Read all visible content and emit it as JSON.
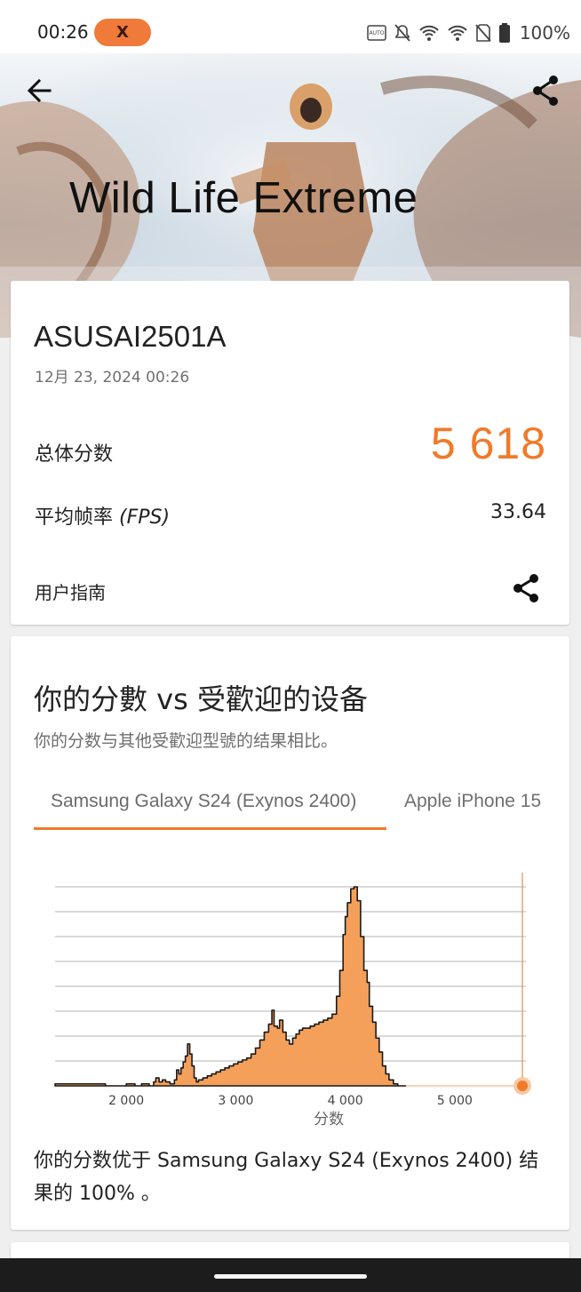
{
  "status_bar": {
    "time": "00:26",
    "badge_text": "X",
    "battery": "100%",
    "icons": [
      "auto-hz-icon",
      "notifications-off-icon",
      "wifi-icon",
      "wifi-icon",
      "no-sim-icon",
      "battery-icon"
    ]
  },
  "header": {
    "title": "Wild Life Extreme",
    "back_icon": "back-arrow-icon",
    "share_icon": "share-icon"
  },
  "result_card": {
    "device_name": "ASUSAI2501A",
    "date": "12月 23, 2024 00:26",
    "total_score_label": "总体分数",
    "total_score": "5 618",
    "fps_label_prefix": "平均帧率 ",
    "fps_label_italic": "(FPS)",
    "fps_value": "33.64",
    "guide_label": "用户指南",
    "score_color": "#f07a2a"
  },
  "compare_card": {
    "title": "你的分數 vs 受歡迎的设备",
    "subtitle": "你的分数与其他受歡迎型號的结果相比。",
    "tabs": [
      {
        "label": "Samsung Galaxy S24 (Exynos 2400)",
        "active": true
      },
      {
        "label": "Apple iPhone 15",
        "active": false
      }
    ],
    "result_text": "你的分数优于 Samsung Galaxy S24 (Exynos 2400) 结果的 100% 。"
  },
  "chart_data": {
    "type": "area",
    "xlabel": "分数",
    "ylabel": "",
    "x_ticks": [
      2000,
      3000,
      4000,
      5000
    ],
    "x_tick_labels": [
      "2 000",
      "3 000",
      "4 000",
      "5 000"
    ],
    "xlim": [
      1350,
      5650
    ],
    "ylim": [
      0,
      100
    ],
    "gridlines": 8,
    "grid": true,
    "fill_color": "#f5a05a",
    "your_score": 5618,
    "series": [
      {
        "x": [
          1350,
          1800,
          1810,
          1990,
          2000,
          2050,
          2080,
          2140,
          2180,
          2210,
          2250,
          2270,
          2300,
          2330,
          2360,
          2400,
          2440,
          2460,
          2480,
          2500,
          2520,
          2540,
          2560,
          2580,
          2600,
          2620,
          2640,
          2660,
          2700,
          2740,
          2780,
          2820,
          2860,
          2900,
          2940,
          2980,
          3020,
          3060,
          3100,
          3140,
          3180,
          3220,
          3260,
          3300,
          3330,
          3350,
          3380,
          3400,
          3430,
          3460,
          3490,
          3520,
          3550,
          3580,
          3610,
          3640,
          3680,
          3720,
          3760,
          3800,
          3840,
          3880,
          3920,
          3950,
          3980,
          4000,
          4020,
          4050,
          4080,
          4110,
          4140,
          4170,
          4200,
          4220,
          4250,
          4280,
          4310,
          4340,
          4370,
          4400,
          4440,
          4480,
          4520,
          4550
        ],
        "y": [
          1,
          1,
          0,
          0,
          1,
          1,
          0,
          1,
          1,
          0,
          2,
          4,
          2,
          3,
          2,
          1,
          3,
          8,
          6,
          9,
          12,
          15,
          21,
          16,
          10,
          4,
          2,
          3,
          4,
          5,
          6,
          7,
          8,
          9,
          10,
          11,
          12,
          13,
          14,
          16,
          19,
          23,
          27,
          31,
          38,
          30,
          29,
          33,
          27,
          23,
          21,
          24,
          26,
          28,
          29,
          29,
          30,
          31,
          32,
          33,
          34,
          36,
          45,
          58,
          76,
          85,
          92,
          99,
          100,
          93,
          75,
          58,
          52,
          40,
          32,
          24,
          17,
          10,
          6,
          3,
          1,
          0,
          0,
          0
        ]
      }
    ]
  }
}
